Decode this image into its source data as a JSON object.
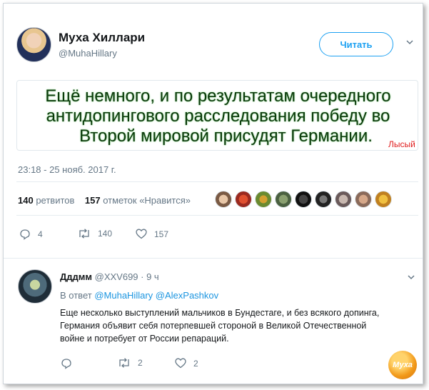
{
  "tweet": {
    "author_name": "Муха Хиллари",
    "author_handle": "@MuhaHillary",
    "follow_label": "Читать",
    "image_text": {
      "line1": "Ещё немного, и по результатам очередного",
      "line2": "антидопингового расследования победу во",
      "line3": "Второй мировой присудят Германии.",
      "signature": "Лысый"
    },
    "timestamp": "23:18 - 25 нояб. 2017 г.",
    "retweets_count": "140",
    "retweets_label": "ретвитов",
    "likes_count": "157",
    "likes_label": "отметок «Нравится»",
    "actions": {
      "replies": "4",
      "retweets": "140",
      "likes": "157"
    }
  },
  "reply": {
    "author_name": "Дддмм",
    "meta": "@XXV699 · 9 ч",
    "reply_prefix": "В ответ",
    "mention1": "@MuhaHillary",
    "mention2": "@AlexPashkov",
    "line1": "Еще несколько выступлений мальчиков в Бундестаге, и без всякого допинга,",
    "line2": "Германия объявит себя потерпевшей стороной в Великой Отечественной",
    "line3": "войне и потребует от России репараций.",
    "actions": {
      "retweets": "2",
      "likes": "2"
    }
  },
  "watermark": {
    "text": "Муха"
  },
  "colors": {
    "accent": "#1da1f2",
    "mention": "#1b95e0",
    "secondary_text": "#657786",
    "image_text": "#0c3a0c",
    "signature": "#e02020"
  },
  "icons": [
    "chevron-down-icon",
    "reply-icon",
    "retweet-icon",
    "heart-icon"
  ]
}
